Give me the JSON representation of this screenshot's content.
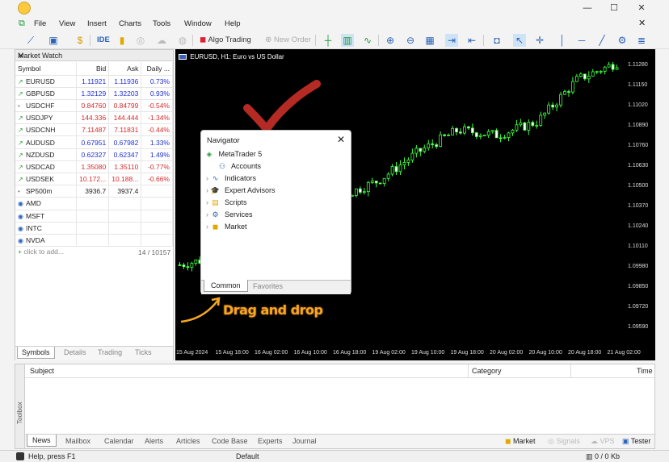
{
  "window": {
    "minimize": "—",
    "maximize": "☐",
    "close": "✕"
  },
  "menu": [
    "File",
    "View",
    "Insert",
    "Charts",
    "Tools",
    "Window",
    "Help"
  ],
  "toolbar": {
    "ide": "IDE",
    "algo_trading": "Algo Trading",
    "new_order": "New Order"
  },
  "market_watch": {
    "title": "Market Watch",
    "columns": [
      "Symbol",
      "Bid",
      "Ask",
      "Daily ..."
    ],
    "rows": [
      {
        "dir": "up",
        "symbol": "EURUSD",
        "bid": "1.11921",
        "ask": "1.11936",
        "daily": "0.73%",
        "cls": "up"
      },
      {
        "dir": "up",
        "symbol": "GBPUSD",
        "bid": "1.32129",
        "ask": "1.32203",
        "daily": "0.93%",
        "cls": "up"
      },
      {
        "dir": "flat",
        "symbol": "USDCHF",
        "bid": "0.84760",
        "ask": "0.84799",
        "daily": "-0.54%",
        "cls": "dn"
      },
      {
        "dir": "up",
        "symbol": "USDJPY",
        "bid": "144.336",
        "ask": "144.444",
        "daily": "-1.34%",
        "cls": "dn"
      },
      {
        "dir": "up",
        "symbol": "USDCNH",
        "bid": "7.11487",
        "ask": "7.11831",
        "daily": "-0.44%",
        "cls": "dn"
      },
      {
        "dir": "up",
        "symbol": "AUDUSD",
        "bid": "0.67951",
        "ask": "0.67982",
        "daily": "1.33%",
        "cls": "up"
      },
      {
        "dir": "up",
        "symbol": "NZDUSD",
        "bid": "0.62327",
        "ask": "0.62347",
        "daily": "1.49%",
        "cls": "up"
      },
      {
        "dir": "up",
        "symbol": "USDCAD",
        "bid": "1.35080",
        "ask": "1.35110",
        "daily": "-0.77%",
        "cls": "dn"
      },
      {
        "dir": "up",
        "symbol": "USDSEK",
        "bid": "10.172...",
        "ask": "10.188...",
        "daily": "-0.66%",
        "cls": "dn"
      },
      {
        "dir": "flat",
        "symbol": "SP500m",
        "bid": "3936.7",
        "ask": "3937.4",
        "daily": "",
        "cls": "flat"
      },
      {
        "dir": "stock",
        "symbol": "AMD",
        "bid": "",
        "ask": "",
        "daily": "",
        "cls": "flat"
      },
      {
        "dir": "stock",
        "symbol": "MSFT",
        "bid": "",
        "ask": "",
        "daily": "",
        "cls": "flat"
      },
      {
        "dir": "stock",
        "symbol": "INTC",
        "bid": "",
        "ask": "",
        "daily": "",
        "cls": "flat"
      },
      {
        "dir": "stock",
        "symbol": "NVDA",
        "bid": "",
        "ask": "",
        "daily": "",
        "cls": "flat"
      }
    ],
    "add_label": "click to add...",
    "count": "14 / 10157",
    "tabs": [
      "Symbols",
      "Details",
      "Trading",
      "Ticks"
    ]
  },
  "chart": {
    "title": "EURUSD, H1:  Euro vs US Dollar",
    "price_labels": [
      "1.11280",
      "1.11150",
      "1.11020",
      "1.10890",
      "1.10760",
      "1.10630",
      "1.10500",
      "1.10370",
      "1.10240",
      "1.10110",
      "1.09980",
      "1.09850",
      "1.09720",
      "1.09590"
    ],
    "time_labels": [
      "15 Aug 2024",
      "15 Aug 18:00",
      "16 Aug 02:00",
      "16 Aug 10:00",
      "16 Aug 18:00",
      "19 Aug 02:00",
      "19 Aug 10:00",
      "19 Aug 18:00",
      "20 Aug 02:00",
      "20 Aug 10:00",
      "20 Aug 18:00",
      "21 Aug 02:00"
    ]
  },
  "chart_data": {
    "type": "candlestick",
    "title": "EURUSD, H1:  Euro vs US Dollar",
    "x": [
      "15 Aug 2024",
      "15 Aug 18:00",
      "16 Aug 02:00",
      "16 Aug 10:00",
      "16 Aug 18:00",
      "19 Aug 02:00",
      "19 Aug 10:00",
      "19 Aug 18:00",
      "20 Aug 02:00",
      "20 Aug 10:00",
      "20 Aug 18:00",
      "21 Aug 02:00"
    ],
    "close": [
      1.1005,
      1.101,
      1.102,
      1.103,
      1.1045,
      1.1055,
      1.1072,
      1.1085,
      1.1082,
      1.109,
      1.1115,
      1.1125
    ],
    "ylim": [
      1.0955,
      1.1133
    ]
  },
  "navigator": {
    "title": "Navigator",
    "root": "MetaTrader 5",
    "items": [
      "Accounts",
      "Indicators",
      "Expert Advisors",
      "Scripts",
      "Services",
      "Market"
    ],
    "tabs": [
      "Common",
      "Favorites"
    ]
  },
  "annotation": {
    "text": "Drag and drop"
  },
  "toolbox": {
    "side_label": "Toolbox",
    "columns": [
      "Subject",
      "Category",
      "Time"
    ],
    "tabs": [
      "News",
      "Mailbox",
      "Calendar",
      "Alerts",
      "Articles",
      "Code Base",
      "Experts",
      "Journal"
    ],
    "right": [
      "Market",
      "Signals",
      "VPS",
      "Tester"
    ]
  },
  "status": {
    "help": "Help, press F1",
    "profile": "Default",
    "traffic": "0 / 0 Kb"
  }
}
